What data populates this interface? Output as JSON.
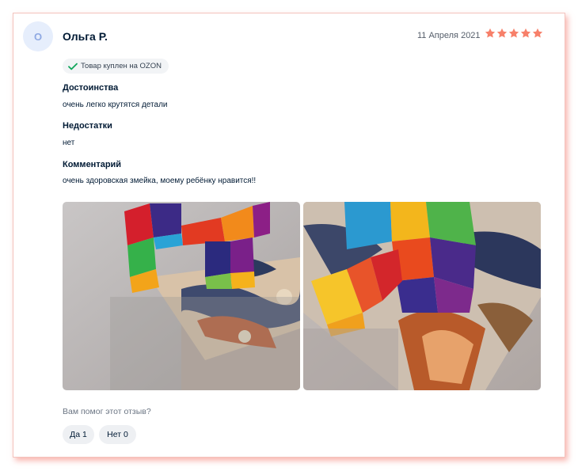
{
  "review": {
    "avatar_initial": "О",
    "author": "Ольга Р.",
    "date": "11 Апреля 2021",
    "rating": 5,
    "star_color": "#f7806a",
    "badge": "Товар куплен на OZON",
    "pros_title": "Достоинства",
    "pros_text": "очень легко крутятся детали",
    "cons_title": "Недостатки",
    "cons_text": "нет",
    "comment_title": "Комментарий",
    "comment_text": "очень здоровская змейка, моему ребёнку нравится!!",
    "photos": [
      "review-photo-1",
      "review-photo-2"
    ]
  },
  "feedback": {
    "question": "Вам помог этот отзыв?",
    "yes_label": "Да",
    "yes_count": "1",
    "no_label": "Нет",
    "no_count": "0"
  }
}
